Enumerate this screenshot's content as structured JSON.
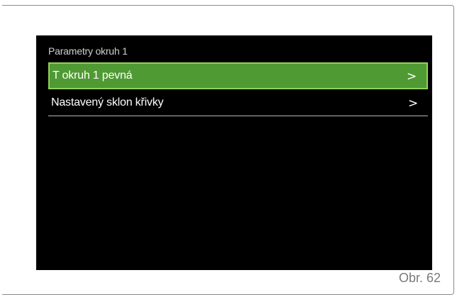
{
  "screen": {
    "section_title": "Parametry okruh 1",
    "items": [
      {
        "label": "T okruh 1 pevná",
        "arrow": ">",
        "selected": true
      },
      {
        "label": "Nastavený sklon křivky",
        "arrow": ">",
        "selected": false
      }
    ]
  },
  "figure": {
    "caption": "Obr. 62"
  },
  "colors": {
    "selected_background": "#4f9a32",
    "selected_border": "#8fd35a",
    "screen_background": "#000000"
  }
}
